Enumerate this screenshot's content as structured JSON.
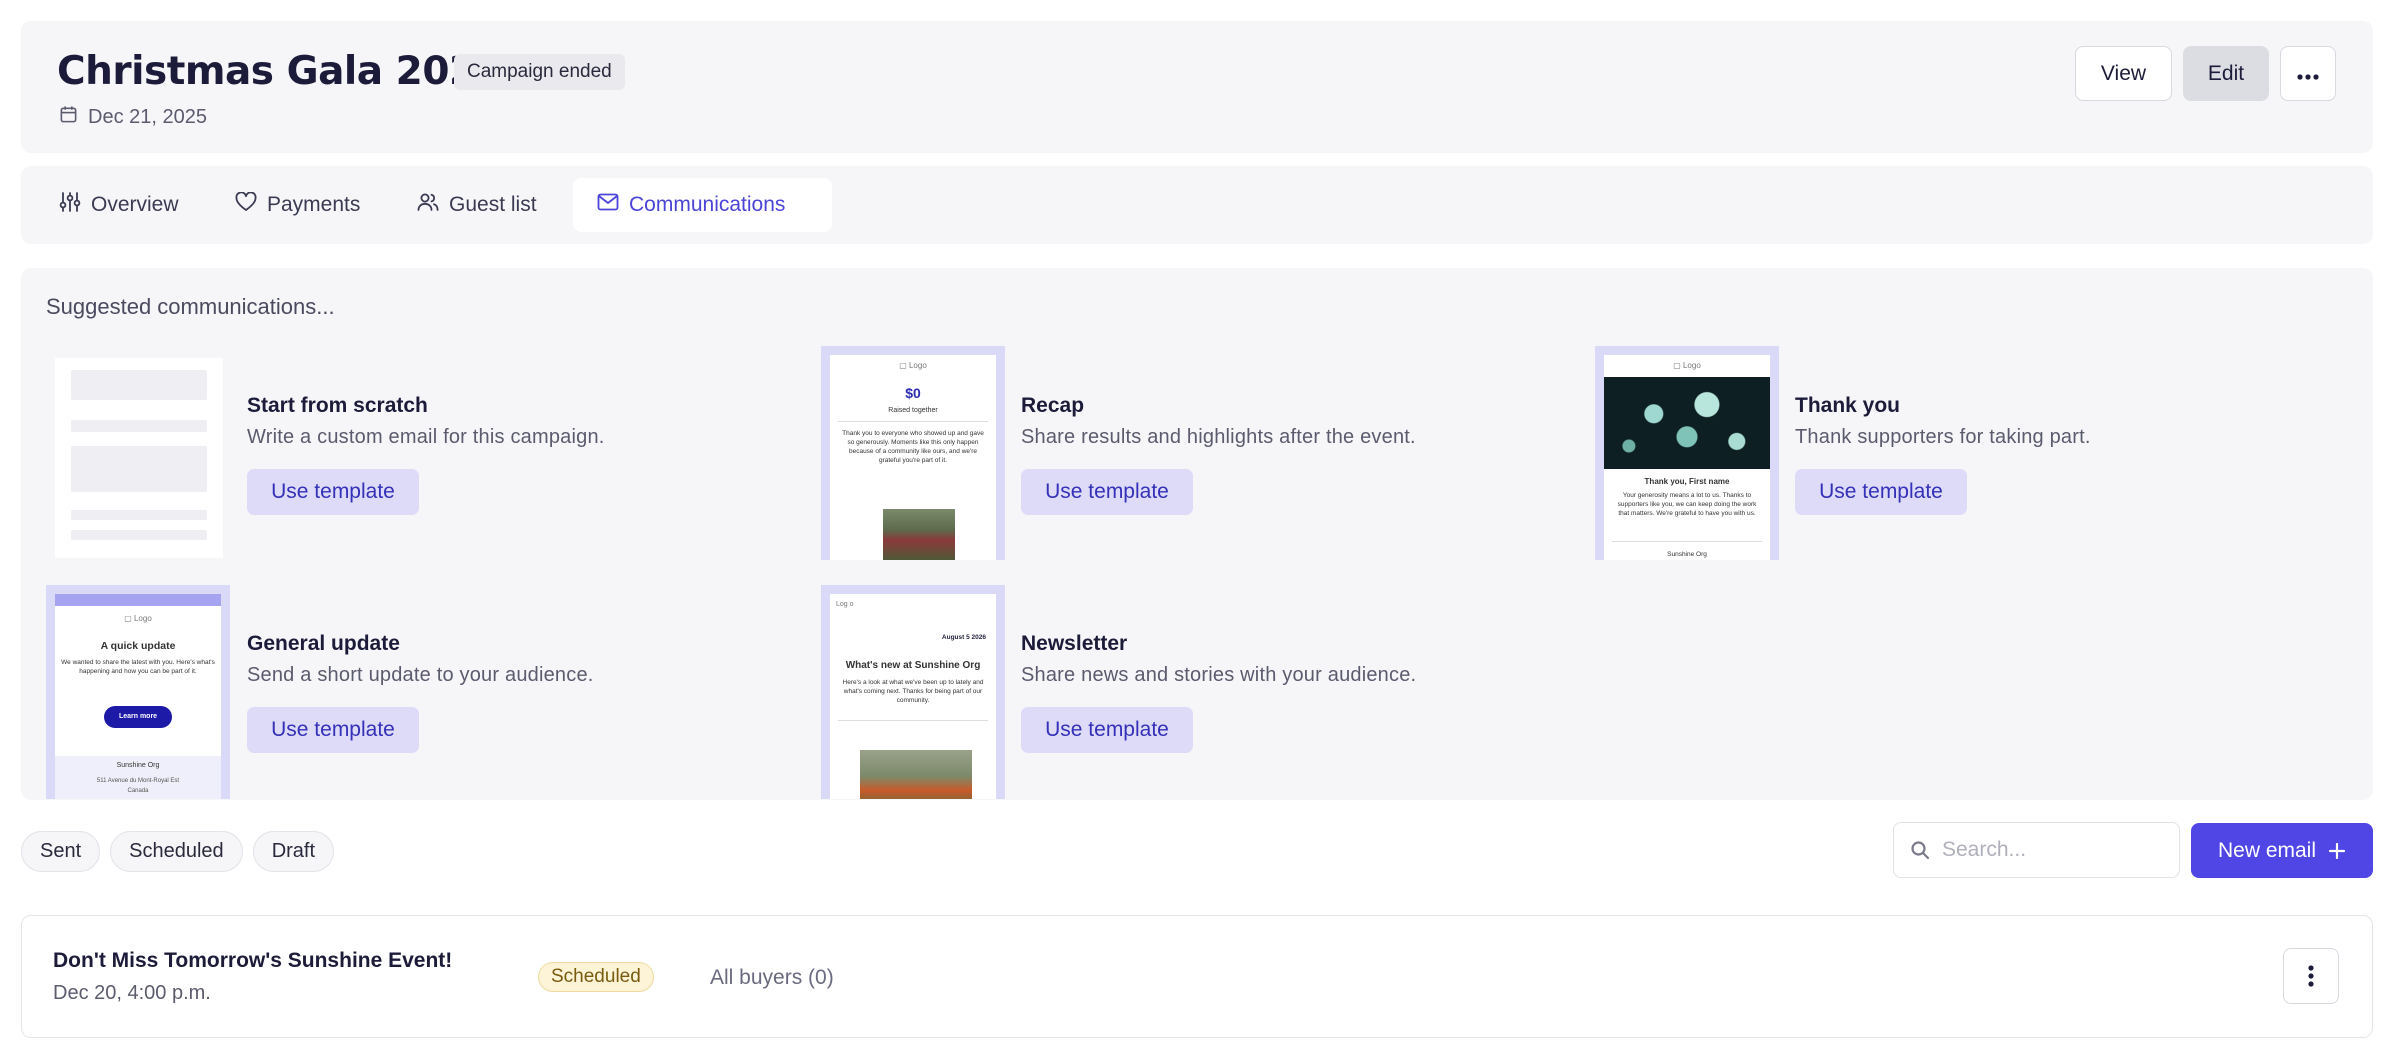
{
  "header": {
    "title": "Christmas Gala 2025",
    "status": "Campaign ended",
    "date": "Dec 21, 2025",
    "view_label": "View",
    "edit_label": "Edit"
  },
  "tabs": [
    {
      "label": "Overview",
      "icon": "sliders-icon"
    },
    {
      "label": "Payments",
      "icon": "heart-icon"
    },
    {
      "label": "Guest list",
      "icon": "users-icon"
    },
    {
      "label": "Communications",
      "icon": "mail-icon",
      "active": true
    }
  ],
  "suggested": {
    "title": "Suggested communications...",
    "use_label": "Use template",
    "templates": [
      {
        "name": "Start from scratch",
        "desc": "Write a custom email for this campaign."
      },
      {
        "name": "Recap",
        "desc": "Share results and highlights after the event."
      },
      {
        "name": "Thank you",
        "desc": "Thank supporters for taking part."
      },
      {
        "name": "General update",
        "desc": "Send a short update to your audience."
      },
      {
        "name": "Newsletter",
        "desc": "Share news and stories with your audience."
      }
    ]
  },
  "thumbs": {
    "logo": "Logo",
    "recap_amount": "$0",
    "recap_sub": "Raised together",
    "recap_body": "Thank you to everyone who showed up and gave so generously. Moments like this only happen because of a community like ours, and we're grateful you're part of it.",
    "thanks_title": "Thank you, First name",
    "thanks_body": "Your generosity means a lot to us. Thanks to supporters like you, we can keep doing the work that matters. We're grateful to have you with us.",
    "thanks_footer": "Sunshine Org",
    "update_title": "A quick update",
    "update_body": "We wanted to share the latest with you. Here's what's happening and how you can be part of it.",
    "update_cta": "Learn more",
    "update_org": "Sunshine Org",
    "update_addr": "511 Avenue du Mont-Royal Est",
    "update_country": "Canada",
    "news_logo": "Log o",
    "news_date": "August 5 2026",
    "news_title": "What's new at Sunshine Org",
    "news_body": "Here's a look at what we've been up to lately and what's coming next. Thanks for being part of our community."
  },
  "filters": [
    "Sent",
    "Scheduled",
    "Draft"
  ],
  "search": {
    "placeholder": "Search..."
  },
  "new_email_label": "New email",
  "emails": [
    {
      "subject": "Don't Miss Tomorrow's Sunshine Event!",
      "date": "Dec 20, 4:00 p.m.",
      "status": "Scheduled",
      "audience": "All buyers (0)"
    }
  ],
  "colors": {
    "accent": "#4f46e5",
    "template_frame": "#dad9f7",
    "use_button_bg": "#dddbf8"
  }
}
